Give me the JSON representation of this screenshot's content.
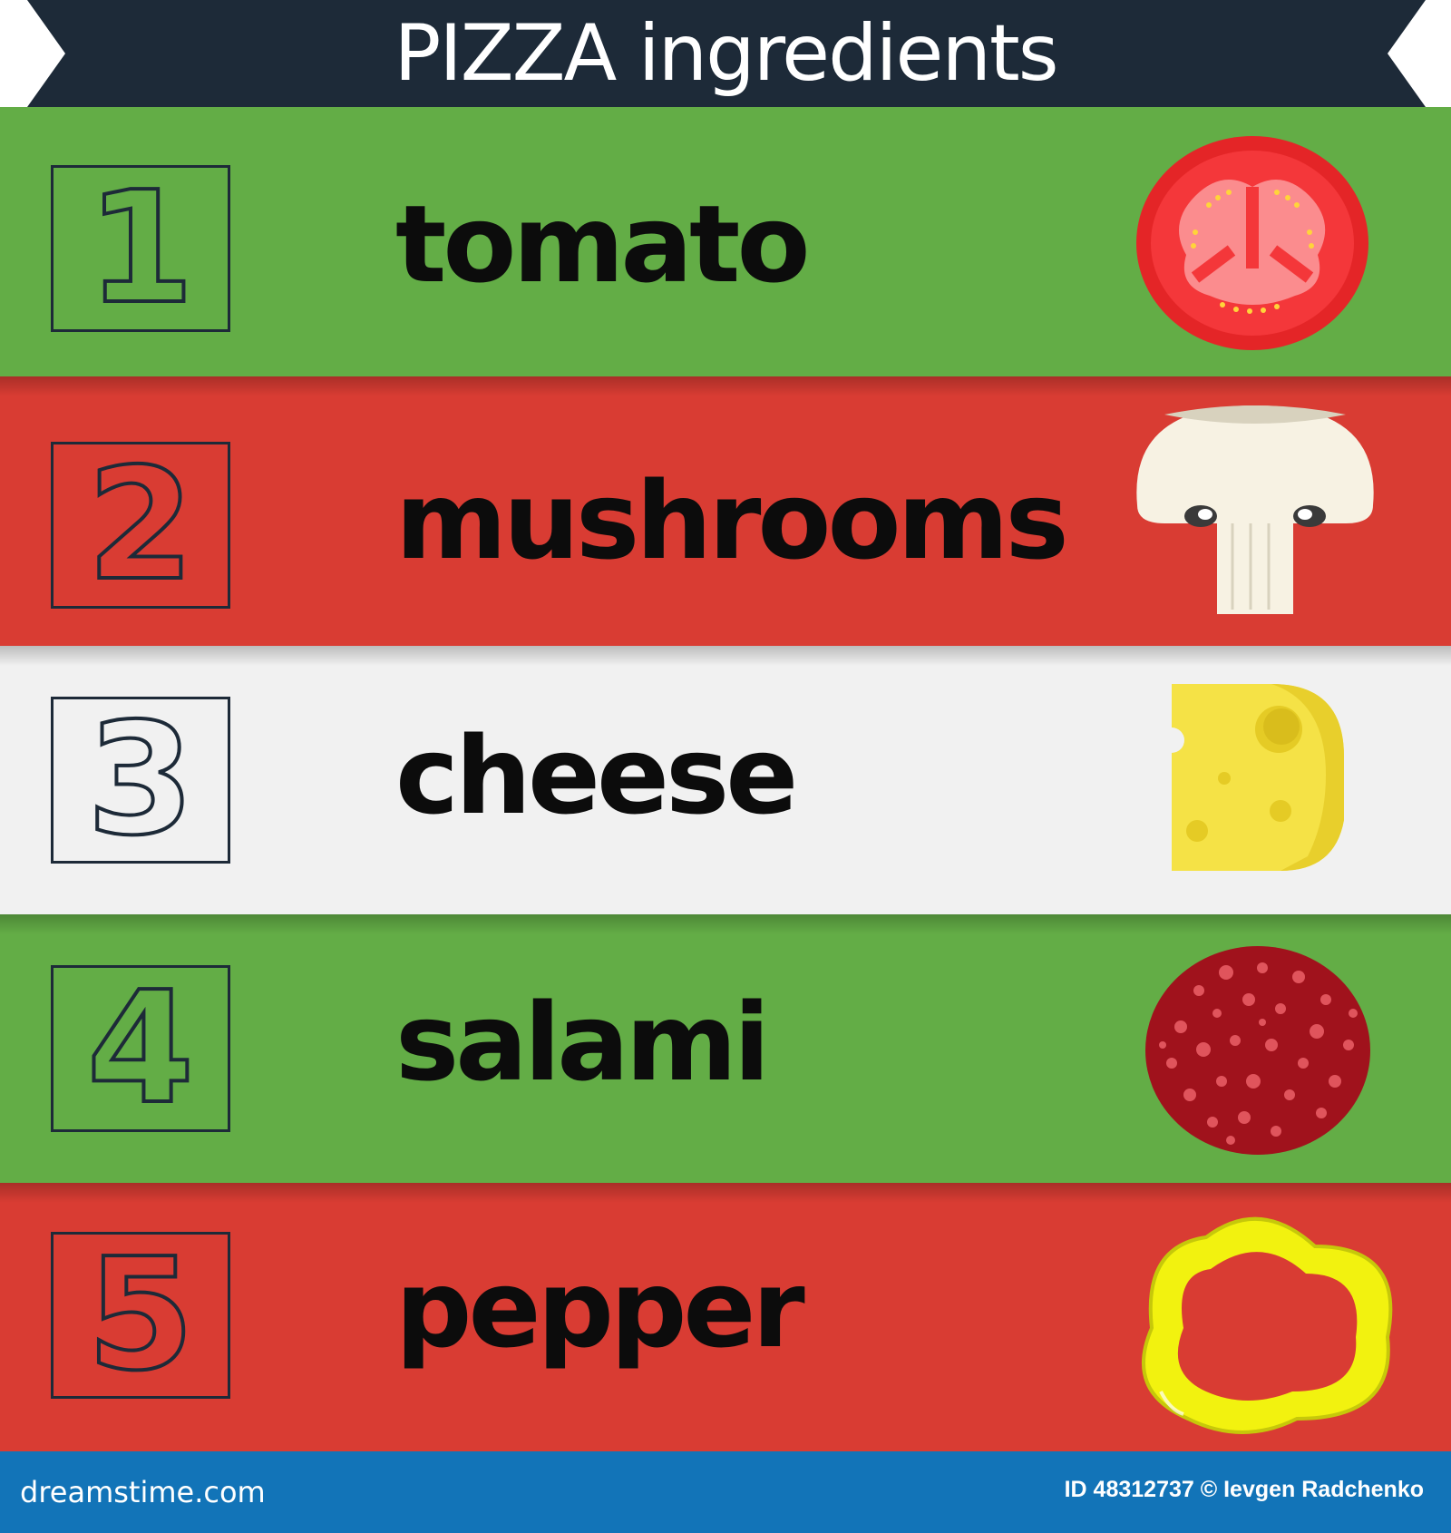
{
  "title": "PIZZA ingredients",
  "colors": {
    "banner": "#1d2a38",
    "green": "#63ad46",
    "red": "#d93c33",
    "white": "#f1f1f1",
    "footer": "#1274b8"
  },
  "ingredients": [
    {
      "number": "1",
      "label": "tomato",
      "icon": "tomato-slice-icon",
      "band": "green"
    },
    {
      "number": "2",
      "label": "mushrooms",
      "icon": "mushroom-icon",
      "band": "red"
    },
    {
      "number": "3",
      "label": "cheese",
      "icon": "cheese-icon",
      "band": "white"
    },
    {
      "number": "4",
      "label": "salami",
      "icon": "salami-icon",
      "band": "green"
    },
    {
      "number": "5",
      "label": "pepper",
      "icon": "pepper-ring-icon",
      "band": "red"
    }
  ],
  "footer": {
    "site": "dreamstime.com",
    "credit": "ID 48312737 © Ievgen Radchenko"
  },
  "watermark": {
    "text": "dreamstime",
    "icon": "spiral-logo-icon"
  }
}
